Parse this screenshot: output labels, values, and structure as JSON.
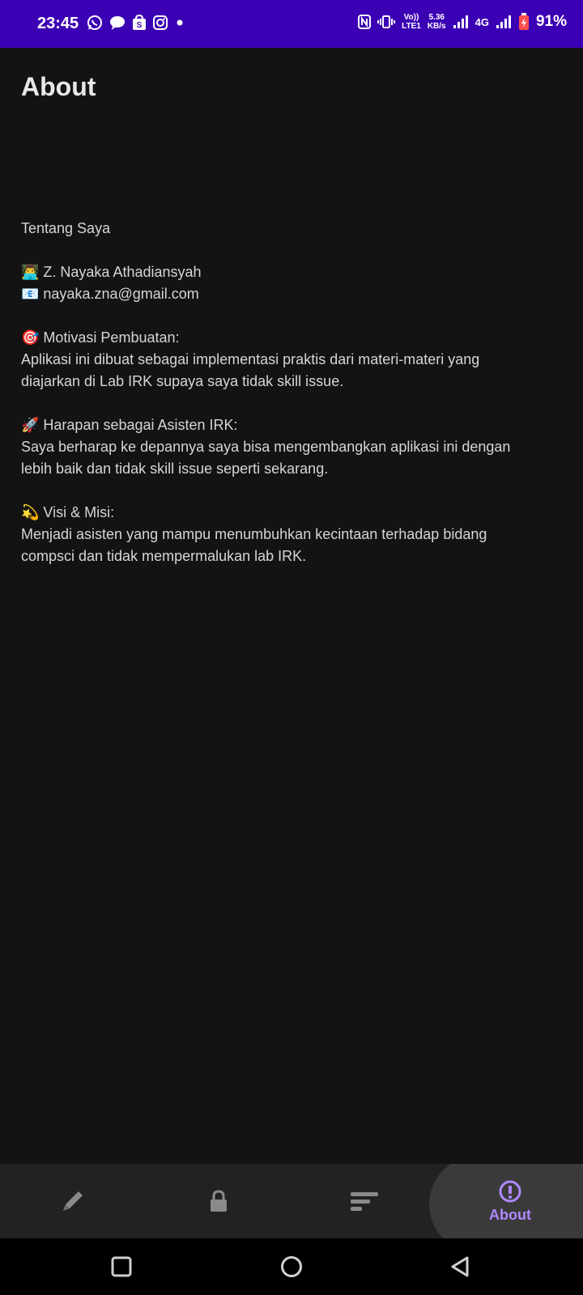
{
  "status_bar": {
    "time": "23:45",
    "net_speed_value": "5.36",
    "net_speed_unit": "KB/s",
    "volte_label": "Vo))",
    "lte_label": "LTE1",
    "network_type": "4G",
    "battery_percent": "91%",
    "notification_icons": [
      "whatsapp-icon",
      "messages-icon",
      "shop-icon",
      "instagram-icon",
      "dot-icon"
    ],
    "background_color": "#3c00b4"
  },
  "page": {
    "title": "About"
  },
  "about": {
    "heading": "Tentang Saya",
    "name_line": "👨‍💻 Z. Nayaka Athadiansyah",
    "email_line": "📧 nayaka.zna@gmail.com",
    "motivation_title": "🎯 Motivasi Pembuatan:",
    "motivation_line1": "Aplikasi ini dibuat sebagai implementasi praktis dari materi-materi yang",
    "motivation_line2": "diajarkan di Lab IRK supaya saya tidak skill issue.",
    "hope_title": "🚀 Harapan sebagai Asisten IRK:",
    "hope_line1": "Saya berharap ke depannya saya bisa mengembangkan aplikasi ini dengan",
    "hope_line2": "lebih baik dan tidak skill issue seperti sekarang.",
    "vision_title": "💫 Visi & Misi:",
    "vision_line1": "Menjadi asisten yang mampu menumbuhkan kecintaan terhadap bidang",
    "vision_line2": "compsci dan tidak mempermalukan lab IRK."
  },
  "bottom_nav": {
    "items": [
      {
        "icon": "pencil-icon"
      },
      {
        "icon": "lock-icon"
      },
      {
        "icon": "sort-icon"
      },
      {
        "icon": "info-icon",
        "label": "About",
        "active": true
      }
    ],
    "active_color": "#b088ff"
  },
  "system_nav": {
    "buttons": [
      "recents-square-icon",
      "home-circle-icon",
      "back-triangle-icon"
    ]
  }
}
